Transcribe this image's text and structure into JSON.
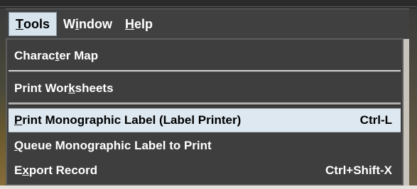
{
  "menubar": {
    "items": [
      {
        "mnemonic": "T",
        "rest": "ools"
      },
      {
        "pre": "W",
        "mnemonic": "i",
        "rest": "ndow"
      },
      {
        "mnemonic": "H",
        "rest": "elp"
      }
    ]
  },
  "menu": {
    "items": [
      {
        "pre": "Charac",
        "mnemonic": "t",
        "rest": "er Map",
        "shortcut": ""
      },
      {
        "pre": "Print Wor",
        "mnemonic": "k",
        "rest": "sheets",
        "shortcut": ""
      },
      {
        "pre": "",
        "mnemonic": "P",
        "rest": "rint Monographic Label (Label Printer)",
        "shortcut": "Ctrl-L"
      },
      {
        "pre": "",
        "mnemonic": "Q",
        "rest": "ueue Monographic Label to Print",
        "shortcut": ""
      },
      {
        "pre": "E",
        "mnemonic": "x",
        "rest": "port Record",
        "shortcut": "Ctrl+Shift-X"
      }
    ]
  }
}
